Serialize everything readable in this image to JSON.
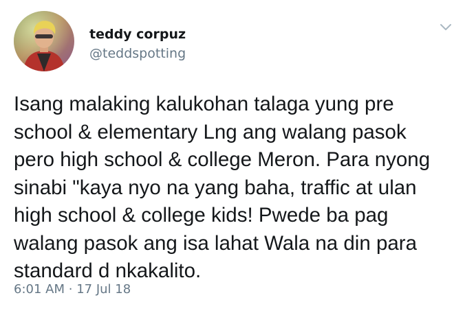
{
  "user": {
    "display_name": "teddy corpuz",
    "handle": "@teddspotting"
  },
  "tweet": {
    "text": "Isang malaking kalukohan talaga yung pre\nschool & elementary Lng ang walang pasok\npero high school & college Meron. Para nyong\nsinabi \"kaya nyo na yang baha, traffic at ulan\nhigh school & college kids! Pwede ba pag\nwalang pasok ang isa lahat Wala na din para\nstandard d nkakalito.",
    "time": "6:01 AM",
    "separator": "·",
    "date": "17 Jul 18"
  },
  "icons": {
    "menu": "chevron-down-icon"
  },
  "colors": {
    "text_primary": "#14171a",
    "text_secondary": "#657786"
  }
}
